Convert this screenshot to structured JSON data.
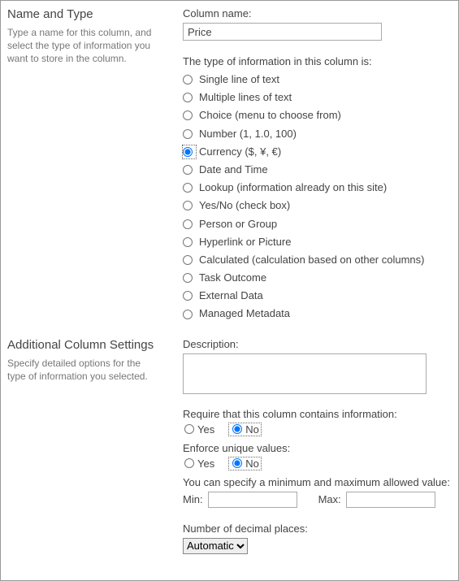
{
  "section1": {
    "title": "Name and Type",
    "desc": "Type a name for this column, and select the type of information you want to store in the column."
  },
  "column_name": {
    "label": "Column name:",
    "value": "Price"
  },
  "type_header": "The type of information in this column is:",
  "types": [
    "Single line of text",
    "Multiple lines of text",
    "Choice (menu to choose from)",
    "Number (1, 1.0, 100)",
    "Currency ($, ¥, €)",
    "Date and Time",
    "Lookup (information already on this site)",
    "Yes/No (check box)",
    "Person or Group",
    "Hyperlink or Picture",
    "Calculated (calculation based on other columns)",
    "Task Outcome",
    "External Data",
    "Managed Metadata"
  ],
  "type_selected_index": 4,
  "section2": {
    "title": "Additional Column Settings",
    "desc": "Specify detailed options for the type of information you selected."
  },
  "description": {
    "label": "Description:",
    "value": ""
  },
  "require": {
    "label": "Require that this column contains information:",
    "yes": "Yes",
    "no": "No",
    "value": "No"
  },
  "unique": {
    "label": "Enforce unique values:",
    "yes": "Yes",
    "no": "No",
    "value": "No"
  },
  "range": {
    "label": "You can specify a minimum and maximum allowed value:",
    "min_label": "Min:",
    "max_label": "Max:",
    "min_value": "",
    "max_value": ""
  },
  "decimals": {
    "label": "Number of decimal places:",
    "value": "Automatic"
  }
}
